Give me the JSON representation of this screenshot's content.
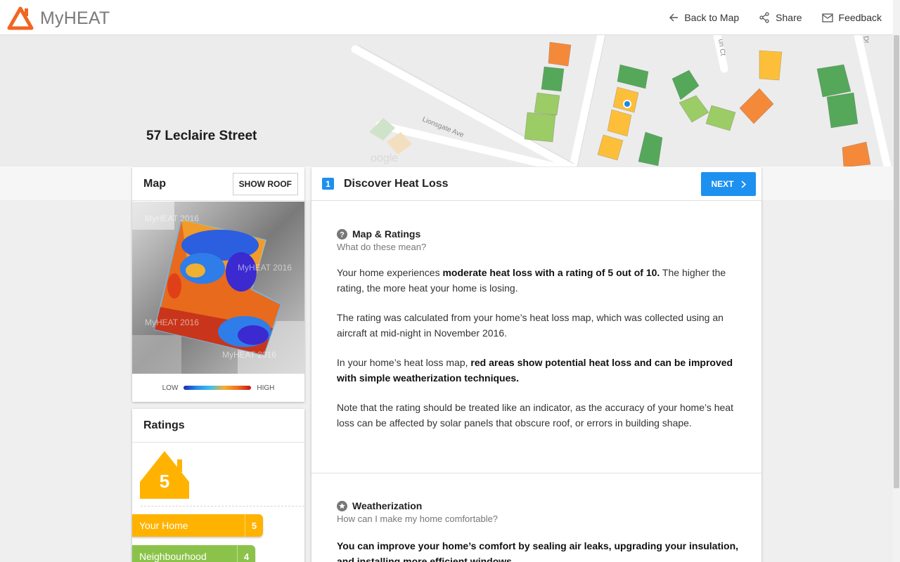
{
  "app": {
    "name": "MyHEAT"
  },
  "nav": {
    "back_label": "Back to Map",
    "share_label": "Share",
    "feedback_label": "Feedback"
  },
  "map": {
    "address": "57 Leclaire Street",
    "street_label": "Lionsgate Ave",
    "street_label_2": "un Ct",
    "street_label_3": "Dr",
    "watermark": "oogle"
  },
  "map_card": {
    "title": "Map",
    "show_roof_label": "SHOW ROOF",
    "watermark": "MyHEAT 2016",
    "legend_low": "LOW",
    "legend_high": "HIGH"
  },
  "ratings_card": {
    "title": "Ratings",
    "house_value": "5",
    "bars": [
      {
        "label": "Your Home",
        "value": "5",
        "color": "#ffb300"
      },
      {
        "label": "Neighbourhood",
        "value": "4",
        "color": "#8bc34a"
      }
    ]
  },
  "main": {
    "step_number": "1",
    "title": "Discover Heat Loss",
    "next_label": "NEXT",
    "sections": [
      {
        "heading": "Map & Ratings",
        "subheading": "What do these mean?",
        "p1_a": "Your home experiences ",
        "p1_b": "moderate heat loss with a rating of 5 out of 10.",
        "p1_c": " The higher the rating, the more heat your home is losing.",
        "p2": "The rating was calculated from your home’s heat loss map, which was collected using an aircraft at mid-night in November 2016.",
        "p3_a": "In your home’s heat loss map, ",
        "p3_b": "red areas show potential heat loss and can be improved with simple weatherization techniques.",
        "p4": "Note that the rating should be treated like an indicator, as the accuracy of your home’s heat loss can be affected by solar panels that obscure roof, or errors in building shape."
      },
      {
        "heading": "Weatherization",
        "subheading": "How can I make my home comfortable?",
        "p1": "You can improve your home’s comfort by sealing air leaks, upgrading your insulation, and installing more efficient windows."
      }
    ]
  },
  "colors": {
    "accent": "#1e90f0",
    "logo": "#f26522",
    "rating": "#ffb300",
    "neighbourhood": "#8bc34a"
  }
}
